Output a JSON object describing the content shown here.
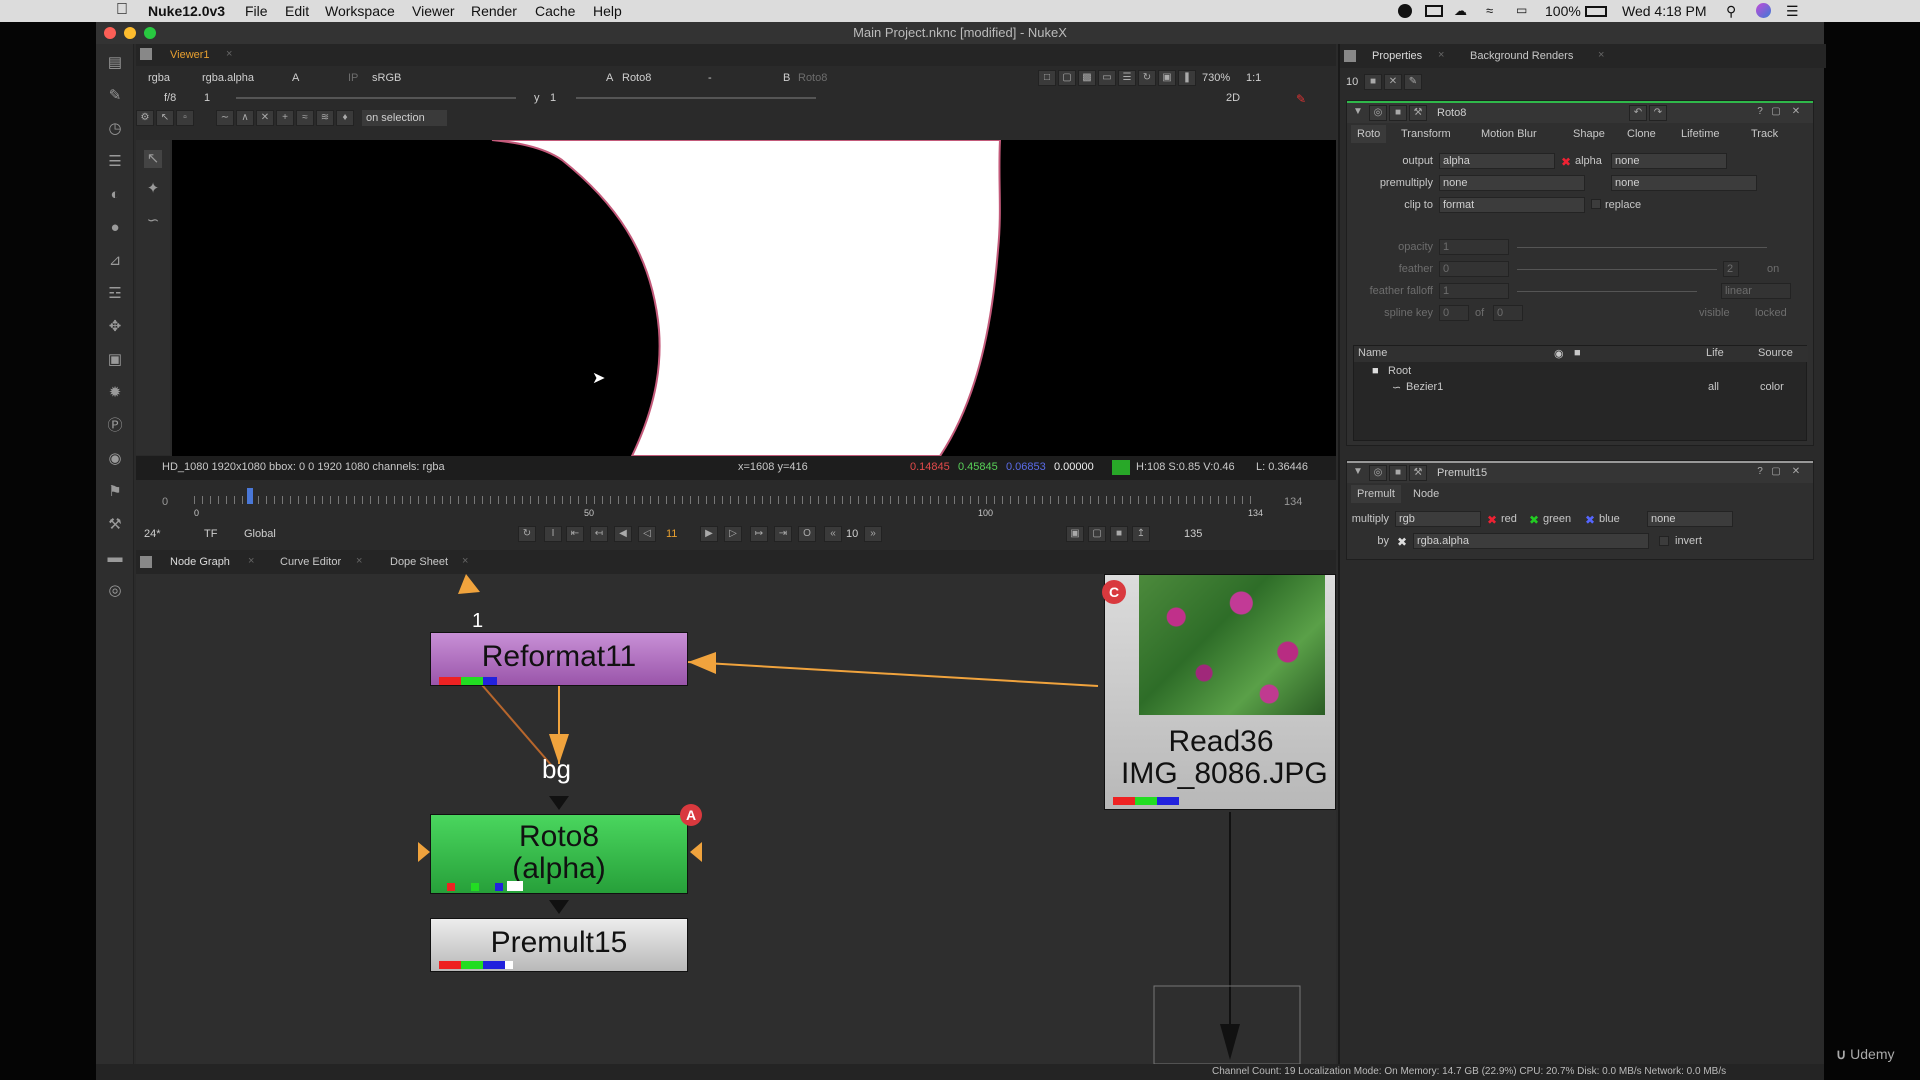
{
  "menubar": {
    "app": "Nuke12.0v3",
    "items": [
      "File",
      "Edit",
      "Workspace",
      "Viewer",
      "Render",
      "Cache",
      "Help"
    ],
    "battery": "100%",
    "clock": "Wed 4:18 PM"
  },
  "window": {
    "title": "Main Project.nknc [modified] - NukeX"
  },
  "viewer": {
    "tab": "Viewer1",
    "channels": "rgba",
    "channel2": "rgba.alpha",
    "input_a": "A",
    "ip": "IP",
    "lut": "sRGB",
    "a_label": "A",
    "a_node": "Roto8",
    "a_op": "-",
    "b_label": "B",
    "b_node": "Roto8",
    "zoom": "730%",
    "ratio": "1:1",
    "fstop": "f/8",
    "f_value": "1",
    "y_label": "y",
    "y_value": "1",
    "view_mode": "2D",
    "selection_mode": "on selection",
    "info_left": "HD_1080 1920x1080  bbox: 0 0 1920 1080 channels: rgba",
    "coords": "x=1608 y=416",
    "px_r": "0.14845",
    "px_g": "0.45845",
    "px_b": "0.06853",
    "px_a": "0.00000",
    "hsv": "H:108 S:0.85 V:0.46",
    "lum": "L: 0.36446",
    "timeline": {
      "start": "0",
      "end": "134",
      "tick0": "0",
      "tick50": "50",
      "tick100": "100",
      "tick134": "134",
      "current": 0.05
    },
    "fps": "24*",
    "tf": "TF",
    "global": "Global",
    "frame": "11",
    "step": "10",
    "end_frame": "135"
  },
  "nodegraph": {
    "tabs": [
      "Node Graph",
      "Curve Editor",
      "Dope Sheet"
    ],
    "nodes": {
      "reformat": "Reformat11",
      "roto_line1": "Roto8",
      "roto_line2": "(alpha)",
      "premult": "Premult15",
      "read_line1": "Read36",
      "read_line2": "IMG_8086.JPG"
    },
    "labels": {
      "input1": "1",
      "bg": "bg",
      "badge_a": "A",
      "badge_c": "C"
    }
  },
  "properties": {
    "tabs": [
      "Properties",
      "Background Renders"
    ],
    "count": "10",
    "roto": {
      "name": "Roto8",
      "tabs": [
        "Roto",
        "Transform",
        "Motion Blur",
        "Shape",
        "Clone",
        "Lifetime",
        "Track"
      ],
      "output_label": "output",
      "output": "alpha",
      "alpha_label": "alpha",
      "output2": "none",
      "premultiply_label": "premultiply",
      "premultiply": "none",
      "premultiply2": "none",
      "clip_label": "clip to",
      "clip": "format",
      "replace_label": "replace",
      "opacity_label": "opacity",
      "opacity": "1",
      "feather_label": "feather",
      "feather": "0",
      "feather_n": "2",
      "feather_on": "on",
      "falloff_label": "feather falloff",
      "falloff": "1",
      "falloff_type": "linear",
      "spline_label": "spline key",
      "spline": "0",
      "of": "of",
      "spline_of": "0",
      "visible": "visible",
      "locked": "locked",
      "table": {
        "name": "Name",
        "life": "Life",
        "source": "Source",
        "root": "Root",
        "bezier": "Bezier1",
        "bezier_life": "all",
        "bezier_source": "color"
      }
    },
    "premult": {
      "name": "Premult15",
      "tabs": [
        "Premult",
        "Node"
      ],
      "multiply_label": "multiply",
      "multiply": "rgb",
      "red": "red",
      "green": "green",
      "blue": "blue",
      "extra": "none",
      "by_label": "by",
      "by": "rgba.alpha",
      "invert": "invert"
    }
  },
  "status": "Channel Count: 19  Localization Mode: On  Memory: 14.7 GB (22.9%)  CPU: 20.7%  Disk: 0.0 MB/s  Network: 0.0 MB/s",
  "watermark": "Udemy",
  "colors": {
    "roto_green": "#2fb84a",
    "reformat_purple": "#a865b8",
    "accent_orange": "#f0a33d",
    "selection": "#e8a74a"
  }
}
